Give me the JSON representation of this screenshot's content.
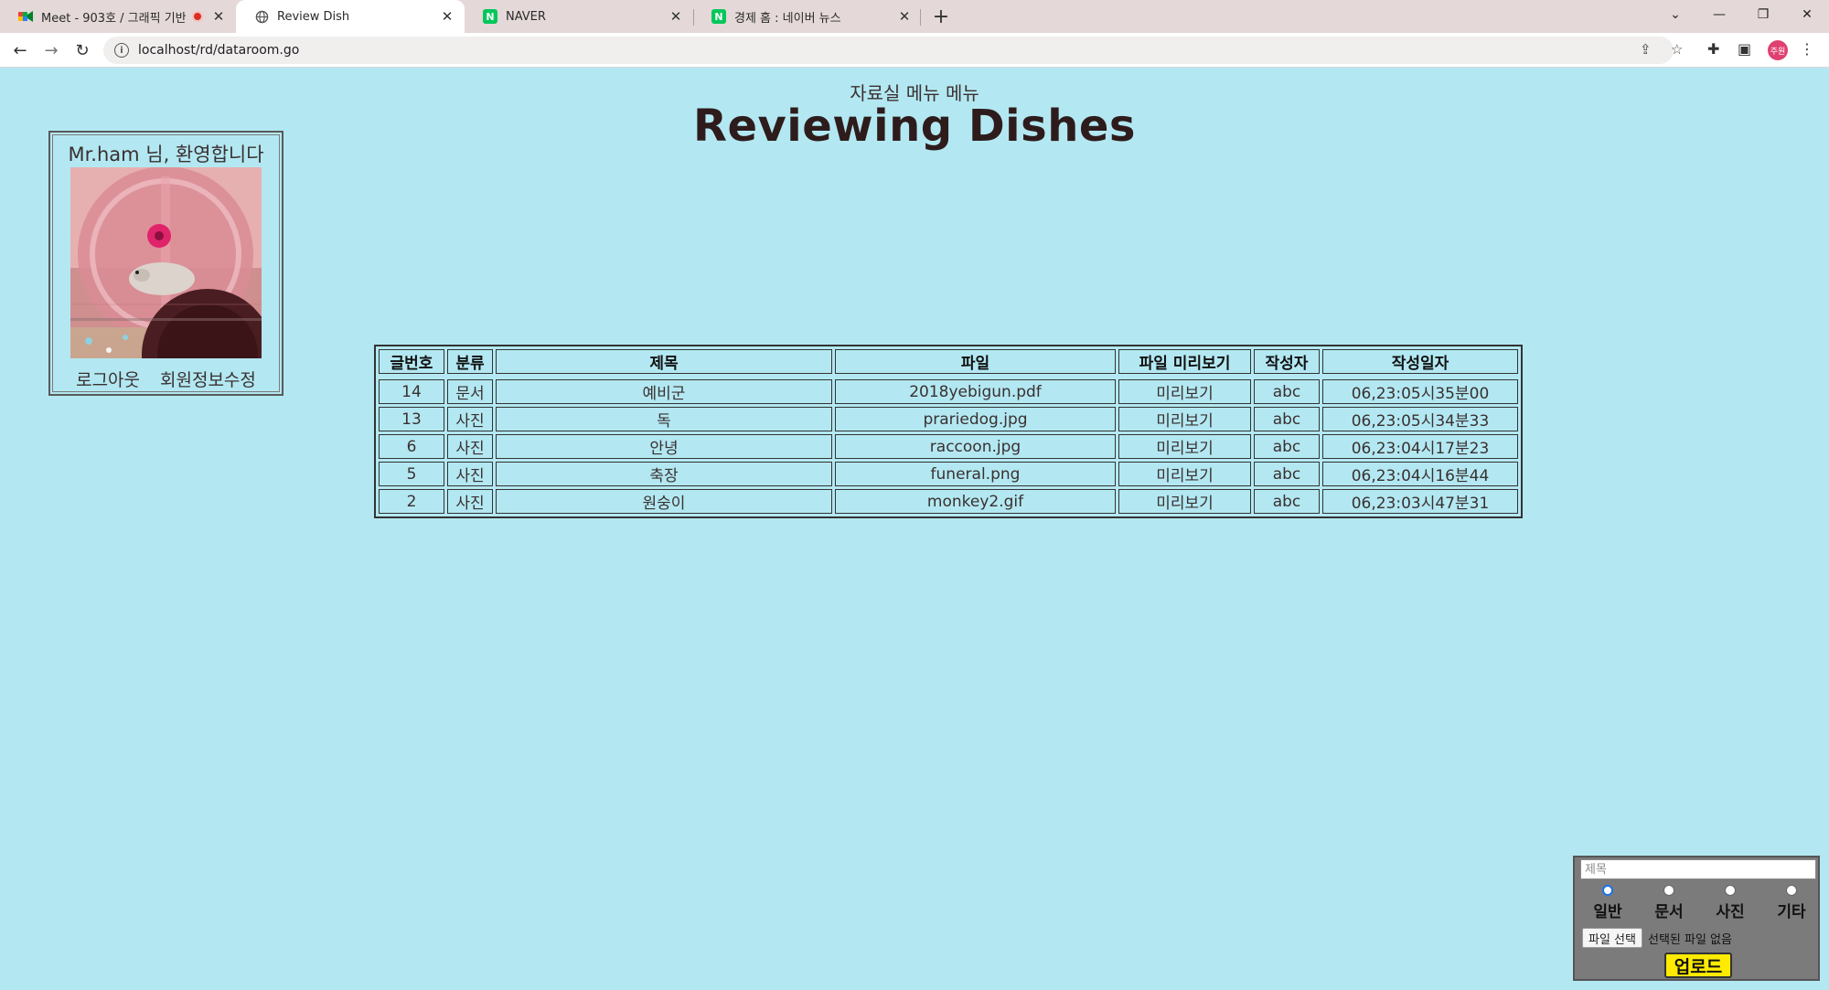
{
  "browser": {
    "tabs": [
      {
        "title": "Meet - 903호 / 그래픽 기반",
        "favicon": "meet-icon",
        "recording": true
      },
      {
        "title": "Review Dish",
        "favicon": "globe-icon"
      },
      {
        "title": "NAVER",
        "favicon": "naver-icon"
      },
      {
        "title": "경제 홈 : 네이버 뉴스",
        "favicon": "naver-icon"
      }
    ],
    "url": "localhost/rd/dataroom.go",
    "profile_initials": "주원"
  },
  "page": {
    "menu_text": "자료실 메뉴 메뉴",
    "title": "Reviewing Dishes"
  },
  "user_box": {
    "welcome": "Mr.ham 님, 환영합니다",
    "logout": "로그아웃",
    "edit_profile": "회원정보수정"
  },
  "table": {
    "headers": [
      "글번호",
      "분류",
      "제목",
      "파일",
      "파일 미리보기",
      "작성자",
      "작성일자"
    ],
    "rows": [
      [
        "14",
        "문서",
        "예비군",
        "2018yebigun.pdf",
        "미리보기",
        "abc",
        "06,23:05시35분00"
      ],
      [
        "13",
        "사진",
        "독",
        "prariedog.jpg",
        "미리보기",
        "abc",
        "06,23:05시34분33"
      ],
      [
        "6",
        "사진",
        "안녕",
        "raccoon.jpg",
        "미리보기",
        "abc",
        "06,23:04시17분23"
      ],
      [
        "5",
        "사진",
        "축장",
        "funeral.png",
        "미리보기",
        "abc",
        "06,23:04시16분44"
      ],
      [
        "2",
        "사진",
        "원숭이",
        "monkey2.gif",
        "미리보기",
        "abc",
        "06,23:03시47분31"
      ]
    ]
  },
  "upload": {
    "title_placeholder": "제목",
    "categories": [
      "일반",
      "문서",
      "사진",
      "기타"
    ],
    "selected_category": "일반",
    "file_button": "파일 선택",
    "file_status": "선택된 파일 없음",
    "submit": "업로드"
  }
}
